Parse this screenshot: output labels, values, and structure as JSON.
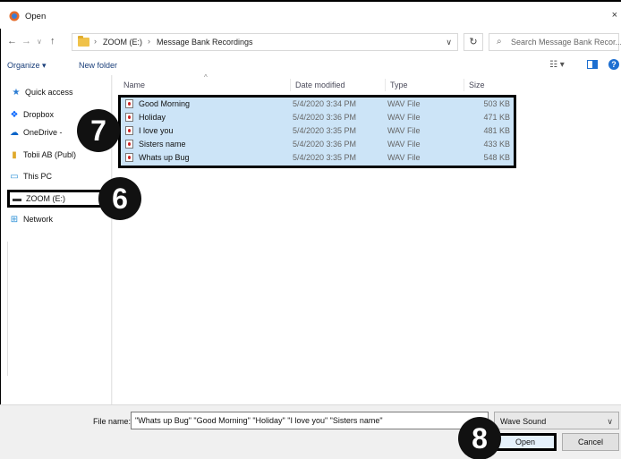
{
  "window": {
    "title": "Open",
    "close_glyph": "×"
  },
  "address_bar": {
    "crumbs": [
      "ZOOM (E:)",
      "Message Bank Recordings"
    ],
    "separator": "›",
    "search_placeholder": "Search Message Bank Recor..."
  },
  "nav": {
    "back": "←",
    "forward": "→",
    "history": "∨",
    "up": "↑",
    "refresh": "↻",
    "search_glyph": "⌕",
    "dropdown": "∨"
  },
  "command_bar": {
    "organize": "Organize ▾",
    "new_folder": "New folder",
    "view": "☷ ▾",
    "help": "?"
  },
  "nav_pane": {
    "items": [
      {
        "label": "Quick access",
        "icon": "★"
      },
      {
        "label": "Dropbox",
        "icon": "❖"
      },
      {
        "label": "OneDrive - ",
        "icon": "☁"
      },
      {
        "label": "Tobii AB (Publ)",
        "icon": "▮"
      },
      {
        "label": "This PC",
        "icon": "▭"
      },
      {
        "label": "ZOOM (E:)",
        "icon": "▬"
      },
      {
        "label": "Network",
        "icon": "⊞"
      }
    ]
  },
  "columns": {
    "name": "Name",
    "date": "Date modified",
    "type": "Type",
    "size": "Size",
    "sort_glyph": "^"
  },
  "files": [
    {
      "name": "Good Morning",
      "date": "5/4/2020 3:34 PM",
      "type": "WAV File",
      "size": "503 KB"
    },
    {
      "name": "Holiday",
      "date": "5/4/2020 3:36 PM",
      "type": "WAV File",
      "size": "471 KB"
    },
    {
      "name": "I love you",
      "date": "5/4/2020 3:35 PM",
      "type": "WAV File",
      "size": "481 KB"
    },
    {
      "name": "Sisters name",
      "date": "5/4/2020 3:36 PM",
      "type": "WAV File",
      "size": "433 KB"
    },
    {
      "name": "Whats up Bug",
      "date": "5/4/2020 3:35 PM",
      "type": "WAV File",
      "size": "548 KB"
    }
  ],
  "footer": {
    "file_name_label": "File name:",
    "file_name_value": "\"Whats up Bug\" \"Good Morning\" \"Holiday\" \"I love you\" \"Sisters name\"",
    "file_type": "Wave Sound",
    "open": "Open",
    "cancel": "Cancel"
  },
  "callouts": {
    "a": "7",
    "b": "6",
    "c": "8"
  },
  "colors": {
    "selection": "#cce4f7",
    "accent": "#1d6fd1",
    "callout": "#111111"
  }
}
